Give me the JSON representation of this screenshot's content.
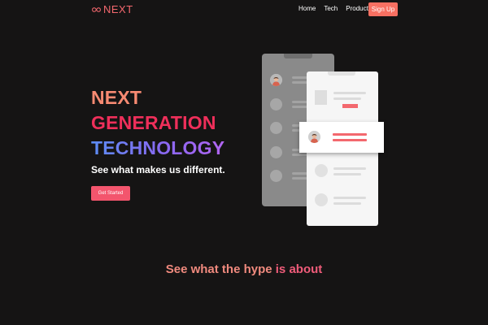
{
  "navbar": {
    "logo_text": "NEXT",
    "logo_icon": "infinity-icon",
    "links": [
      "Home",
      "Tech",
      "Products"
    ],
    "signup_label": "Sign Up"
  },
  "hero": {
    "headline": [
      "NEXT",
      "GENERATION",
      "TECHNOLOGY"
    ],
    "tagline": "See what makes us different.",
    "cta_label": "Get Started"
  },
  "illustration": {
    "icons": [
      "phone-mockup-back",
      "phone-mockup-front",
      "user-avatar-icon",
      "image-placeholder-icon"
    ]
  },
  "section": {
    "heading_part1": "See what the hype ",
    "heading_part2": "is about"
  },
  "colors": {
    "background": "#151414",
    "brand_coral": "#f3686e",
    "signup_button": "#f77062",
    "cta_button": "#f3556d",
    "headline_line1": "#f78a72",
    "headline_line2": "#ef2f5a",
    "headline_line3_gradient": [
      "#5b8cf3",
      "#8a68f1",
      "#b165f2"
    ]
  }
}
